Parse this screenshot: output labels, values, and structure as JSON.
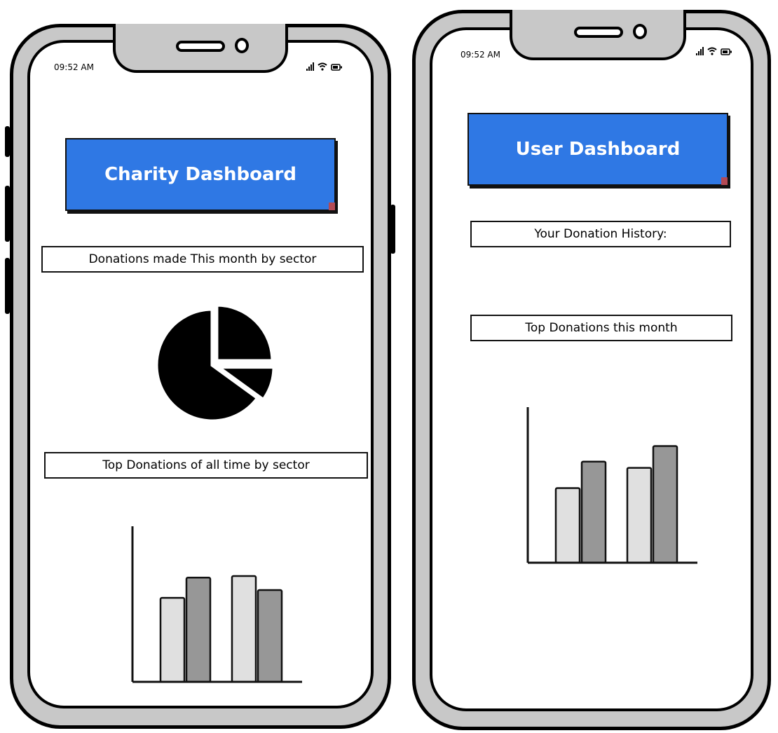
{
  "colors": {
    "banner_blue": "#2f78e4",
    "bar_light": "#e0e0e0",
    "bar_dark": "#979797",
    "frame_gray": "#c8c8c8"
  },
  "charity_phone": {
    "status": {
      "time": "09:52 AM",
      "icons": [
        "signal-icon",
        "wifi-icon",
        "battery-icon"
      ]
    },
    "banner": {
      "label": "Charity Dashboard"
    },
    "monthly_heading": "Donations made This month by sector",
    "alltime_heading": "Top Donations of all time by sector"
  },
  "user_phone": {
    "status": {
      "time": "09:52 AM",
      "icons": [
        "signal-icon",
        "wifi-icon",
        "battery-icon"
      ]
    },
    "banner": {
      "label": "User Dashboard"
    },
    "history_heading": "Your Donation History:",
    "top_month_heading": "Top Donations this month"
  },
  "chart_data": [
    {
      "type": "pie",
      "values": [
        25,
        10,
        65
      ]
    },
    {
      "type": "bar",
      "categories": [
        "",
        ""
      ],
      "series": [
        {
          "values": [
            5.4,
            6.7
          ]
        },
        {
          "values": [
            6.8,
            5.9
          ]
        }
      ],
      "ylim": [
        0,
        10
      ]
    },
    {
      "type": "bar",
      "categories": [
        "",
        ""
      ],
      "series": [
        {
          "values": [
            4.8,
            6.5
          ]
        },
        {
          "values": [
            6.1,
            7.5
          ]
        }
      ],
      "ylim": [
        0,
        10
      ]
    }
  ]
}
